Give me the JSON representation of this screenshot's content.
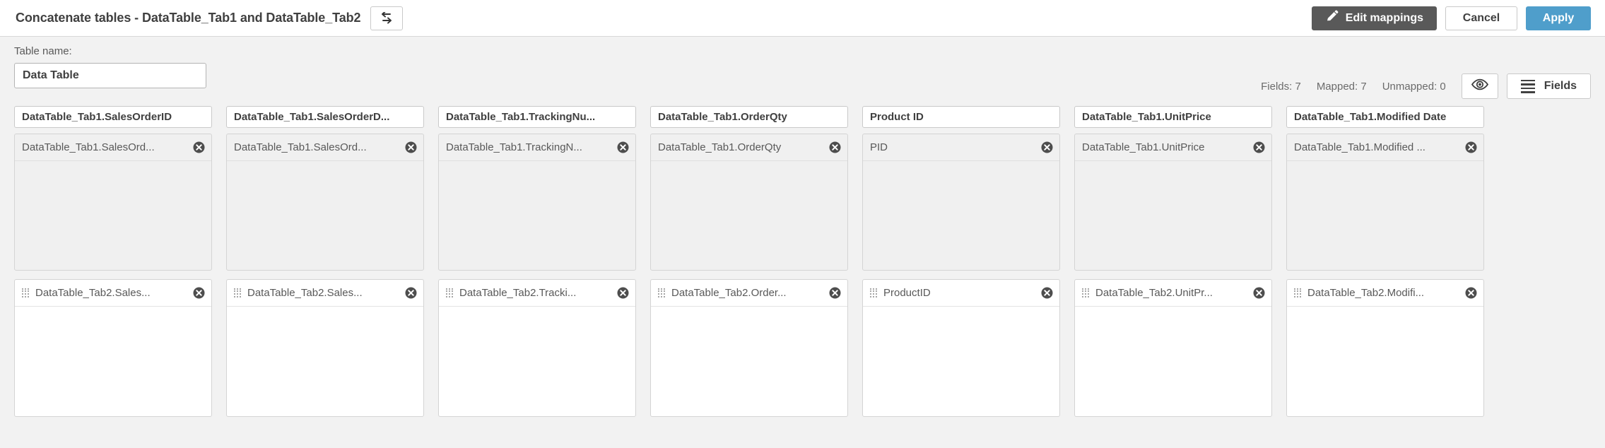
{
  "header": {
    "title": "Concatenate tables - DataTable_Tab1 and DataTable_Tab2",
    "swap_icon": "swap-arrows-icon",
    "edit_mappings_label": "Edit mappings",
    "edit_mappings_icon": "pencil-icon",
    "cancel_label": "Cancel",
    "apply_label": "Apply",
    "accent_color": "#4f9ecb",
    "dark_button_color": "#595959"
  },
  "subheader": {
    "table_name_label": "Table name:",
    "table_name_value": "Data Table",
    "table_name_placeholder": "Table name",
    "fields_count_text": "Fields: 7",
    "mapped_count_text": "Mapped: 7",
    "unmapped_count_text": "Unmapped: 0",
    "preview_icon": "eye-icon",
    "fields_button_label": "Fields",
    "fields_button_icon": "hamburger-icon"
  },
  "columns": [
    {
      "header": "DataTable_Tab1.SalesOrderID",
      "source_chip": "DataTable_Tab1.SalesOrd...",
      "target_chip": "DataTable_Tab2.Sales..."
    },
    {
      "header": "DataTable_Tab1.SalesOrderD...",
      "source_chip": "DataTable_Tab1.SalesOrd...",
      "target_chip": "DataTable_Tab2.Sales..."
    },
    {
      "header": "DataTable_Tab1.TrackingNu...",
      "source_chip": "DataTable_Tab1.TrackingN...",
      "target_chip": "DataTable_Tab2.Tracki..."
    },
    {
      "header": "DataTable_Tab1.OrderQty",
      "source_chip": "DataTable_Tab1.OrderQty",
      "target_chip": "DataTable_Tab2.Order..."
    },
    {
      "header": "Product ID",
      "source_chip": "PID",
      "target_chip": "ProductID"
    },
    {
      "header": "DataTable_Tab1.UnitPrice",
      "source_chip": "DataTable_Tab1.UnitPrice",
      "target_chip": "DataTable_Tab2.UnitPr..."
    },
    {
      "header": "DataTable_Tab1.Modified Date",
      "source_chip": "DataTable_Tab1.Modified ...",
      "target_chip": "DataTable_Tab2.Modifi..."
    }
  ],
  "icons": {
    "remove": "close-circle-icon",
    "drag": "drag-handle-icon"
  }
}
